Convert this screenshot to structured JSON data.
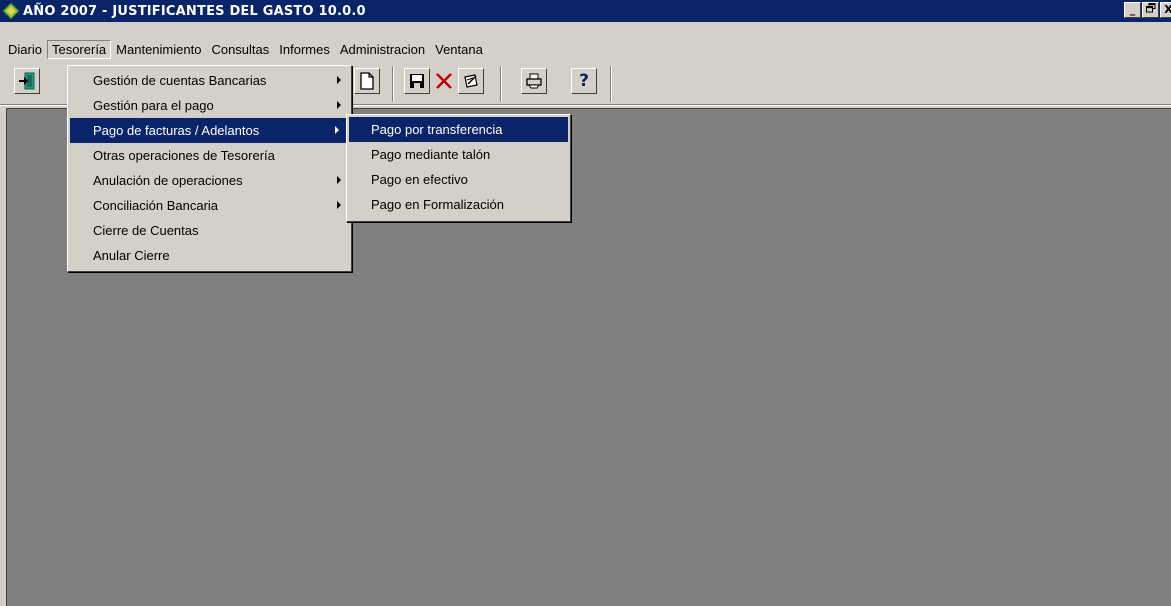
{
  "window": {
    "title": "AÑO 2007 - JUSTIFICANTES DEL GASTO 10.0.0",
    "minimize_glyph": "_",
    "restore_glyph": "🗗",
    "close_glyph": "X"
  },
  "menubar": {
    "items": [
      "Diario",
      "Tesorería",
      "Mantenimiento",
      "Consultas",
      "Informes",
      "Administracion",
      "Ventana"
    ],
    "open_index": 1
  },
  "toolbar": {
    "icons": [
      "exit-icon",
      "new-document-icon",
      "save-icon",
      "delete-icon",
      "edit-icon",
      "print-icon",
      "help-icon"
    ],
    "help_glyph": "?"
  },
  "tesoreria_menu": {
    "items": [
      {
        "label": "Gestión de cuentas Bancarias",
        "has_submenu": true
      },
      {
        "label": "Gestión para el pago",
        "has_submenu": true
      },
      {
        "label": "Pago de facturas / Adelantos",
        "has_submenu": true,
        "highlighted": true
      },
      {
        "label": "Otras operaciones de Tesorería",
        "has_submenu": false
      },
      {
        "label": "Anulación de operaciones",
        "has_submenu": true
      },
      {
        "label": "Conciliación Bancaria",
        "has_submenu": true
      },
      {
        "label": "Cierre de Cuentas",
        "has_submenu": false
      },
      {
        "label": "Anular Cierre",
        "has_submenu": false
      }
    ]
  },
  "pago_submenu": {
    "items": [
      {
        "label": "Pago por transferencia",
        "highlighted": true
      },
      {
        "label": "Pago mediante talón"
      },
      {
        "label": "Pago en efectivo"
      },
      {
        "label": "Pago en Formalización"
      }
    ]
  },
  "colors": {
    "titlebar": "#0a246a",
    "face": "#d4d0c8",
    "mdi_background": "#808080",
    "highlight": "#0a246a"
  }
}
